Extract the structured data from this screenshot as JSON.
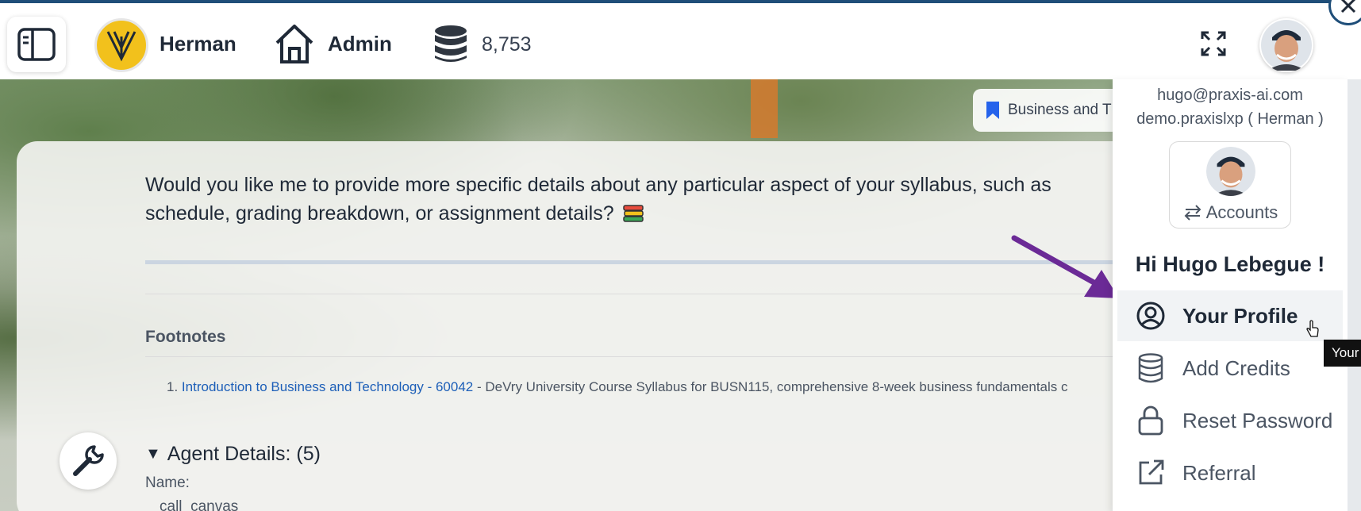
{
  "topbar": {
    "org_name": "Herman",
    "admin_label": "Admin",
    "credits": "8,753"
  },
  "context_chip": {
    "label": "Business and T"
  },
  "chat": {
    "message_line1": "Would you like me to provide more specific details about any particular aspect of your syllabus, such as",
    "message_line2": "schedule, grading breakdown, or assignment details?",
    "footnotes_title": "Footnotes",
    "footnote": {
      "number": "1.",
      "link_text": "Introduction to Business and Technology - 60042",
      "description": " - DeVry University Course Syllabus for BUSN115, comprehensive 8-week business fundamentals c"
    },
    "agent_details": {
      "toggle_symbol": "▼",
      "label": "Agent Details: (5)",
      "name_label": "Name:",
      "name_value": "call_canvas"
    }
  },
  "menu": {
    "email": "hugo@praxis-ai.com",
    "tenant": "demo.praxislxp ( Herman )",
    "accounts_label": "Accounts",
    "greeting": "Hi Hugo Lebegue !",
    "items": [
      {
        "label": "Your Profile",
        "icon": "user-circle-icon",
        "active": true
      },
      {
        "label": "Add Credits",
        "icon": "database-icon"
      },
      {
        "label": "Reset Password",
        "icon": "lock-icon"
      },
      {
        "label": "Referral",
        "icon": "external-link-icon"
      }
    ],
    "tooltip": "Your"
  },
  "colors": {
    "org_logo_yellow": "#f2c11c",
    "link_blue": "#1d5fb8",
    "annotation_arrow": "#6b2a96",
    "bookmark_blue": "#2563eb",
    "top_border": "#1f4e79"
  }
}
